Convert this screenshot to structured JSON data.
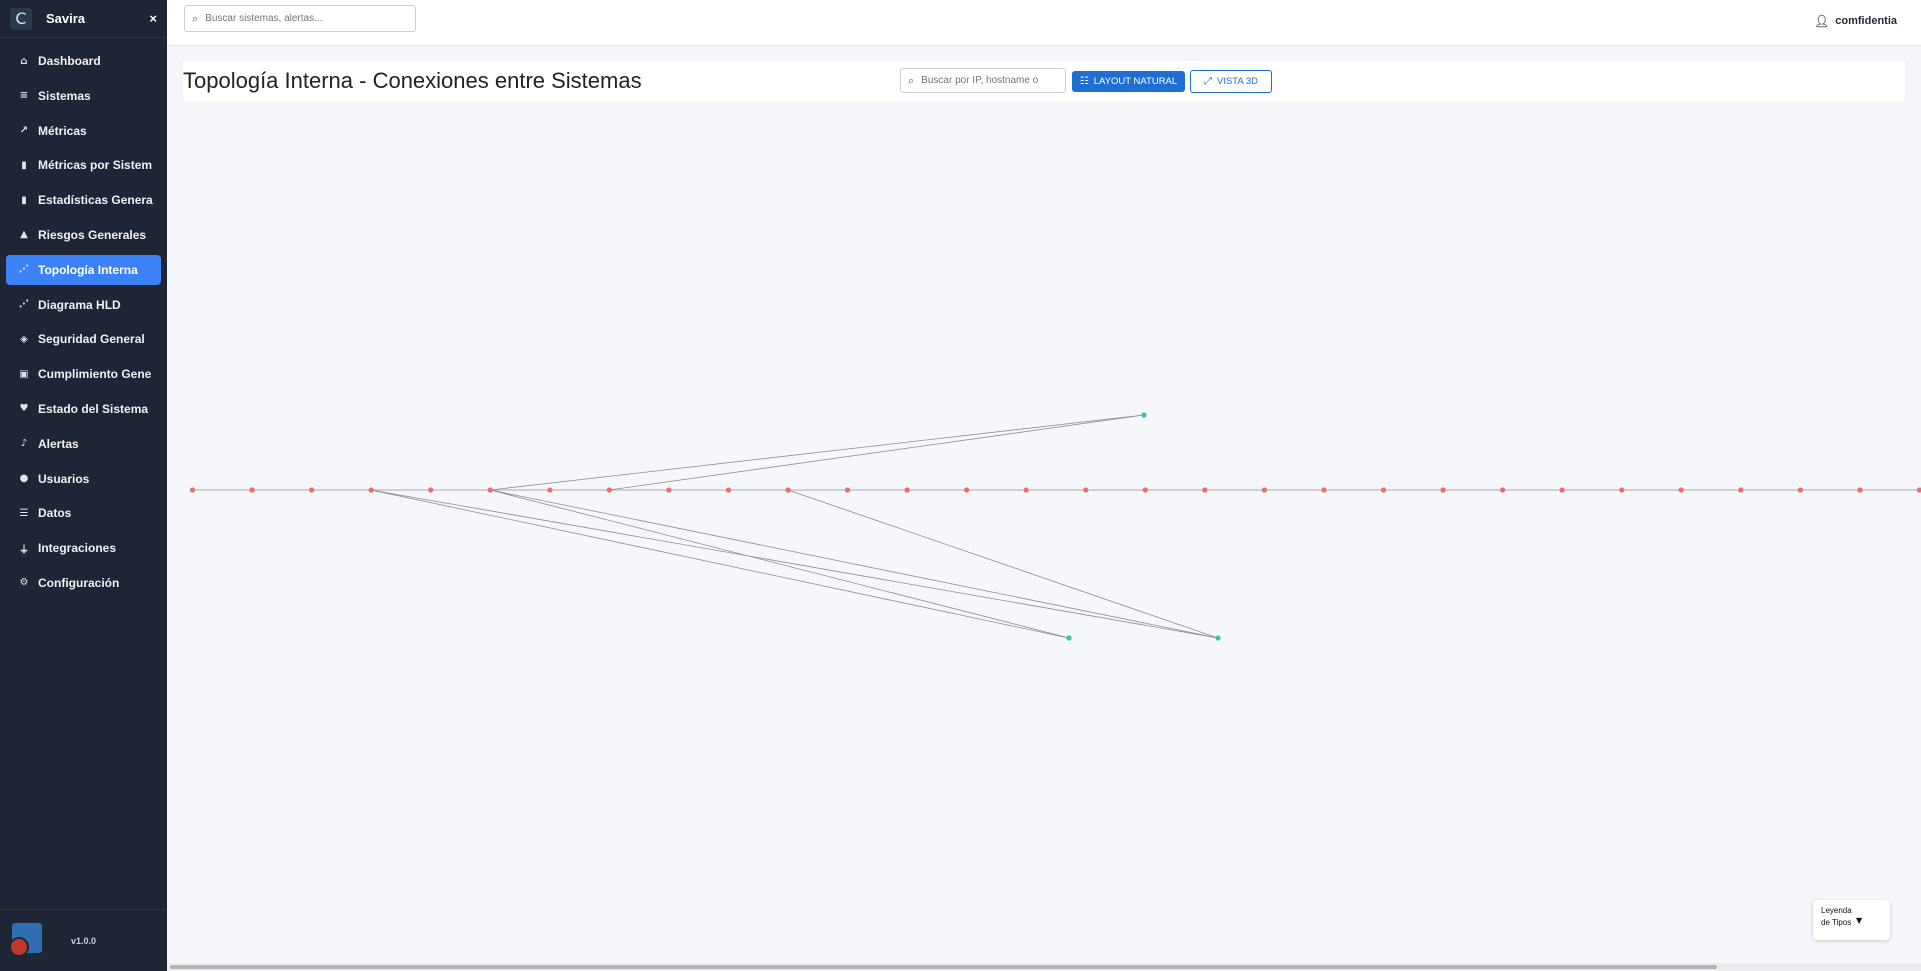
{
  "sidebar": {
    "brand_logo": "C",
    "brand_name": "Savira",
    "close_icon": "×",
    "version": "v1.0.0",
    "items": [
      {
        "label": "Dashboard",
        "icon": "home-icon",
        "glyph": "⌂",
        "active": false
      },
      {
        "label": "Sistemas",
        "icon": "server-icon",
        "glyph": "≡",
        "active": false
      },
      {
        "label": "Métricas",
        "icon": "chart-line-icon",
        "glyph": "↗",
        "active": false
      },
      {
        "label": "Métricas por Sistem",
        "icon": "chart-bar-icon",
        "glyph": "▮",
        "active": false
      },
      {
        "label": "Estadísticas Genera",
        "icon": "chart-bar-icon",
        "glyph": "▮",
        "active": false
      },
      {
        "label": "Riesgos Generales",
        "icon": "warning-icon",
        "glyph": "▲",
        "active": false
      },
      {
        "label": "Topología Interna",
        "icon": "network-icon",
        "glyph": "⋰",
        "active": true
      },
      {
        "label": "Diagrama HLD",
        "icon": "network-icon",
        "glyph": "⋰",
        "active": false
      },
      {
        "label": "Seguridad General",
        "icon": "shield-icon",
        "glyph": "◈",
        "active": false
      },
      {
        "label": "Cumplimiento Gene",
        "icon": "clipboard-check-icon",
        "glyph": "▣",
        "active": false
      },
      {
        "label": "Estado del Sistema",
        "icon": "heart-pulse-icon",
        "glyph": "♥",
        "active": false
      },
      {
        "label": "Alertas",
        "icon": "bell-icon",
        "glyph": "♪",
        "active": false
      },
      {
        "label": "Usuarios",
        "icon": "users-icon",
        "glyph": "●",
        "active": false
      },
      {
        "label": "Datos",
        "icon": "database-icon",
        "glyph": "☰",
        "active": false
      },
      {
        "label": "Integraciones",
        "icon": "plug-icon",
        "glyph": "⏚",
        "active": false
      },
      {
        "label": "Configuración",
        "icon": "gear-icon",
        "glyph": "⚙",
        "active": false
      }
    ]
  },
  "topbar": {
    "search_placeholder": "Buscar sistemas, alertas...",
    "username": "comfidentia"
  },
  "page": {
    "title": "Topología Interna - Conexiones entre Sistemas",
    "search_placeholder": "Buscar por IP, hostname o",
    "layout_button": "LAYOUT NATURAL",
    "view3d_button": "VISTA 3D"
  },
  "legend": {
    "label": "Leyenda de Tipos",
    "caret": "▼"
  },
  "colors": {
    "sidebar_bg": "#1e2535",
    "active_item": "#3b82f6",
    "primary": "#1f6fd0",
    "node_red": "#f26b6b",
    "node_teal": "#3cc0b3",
    "edge": "#8a8f96"
  },
  "graph": {
    "node_count_red": 30,
    "node_count_teal": 3
  }
}
